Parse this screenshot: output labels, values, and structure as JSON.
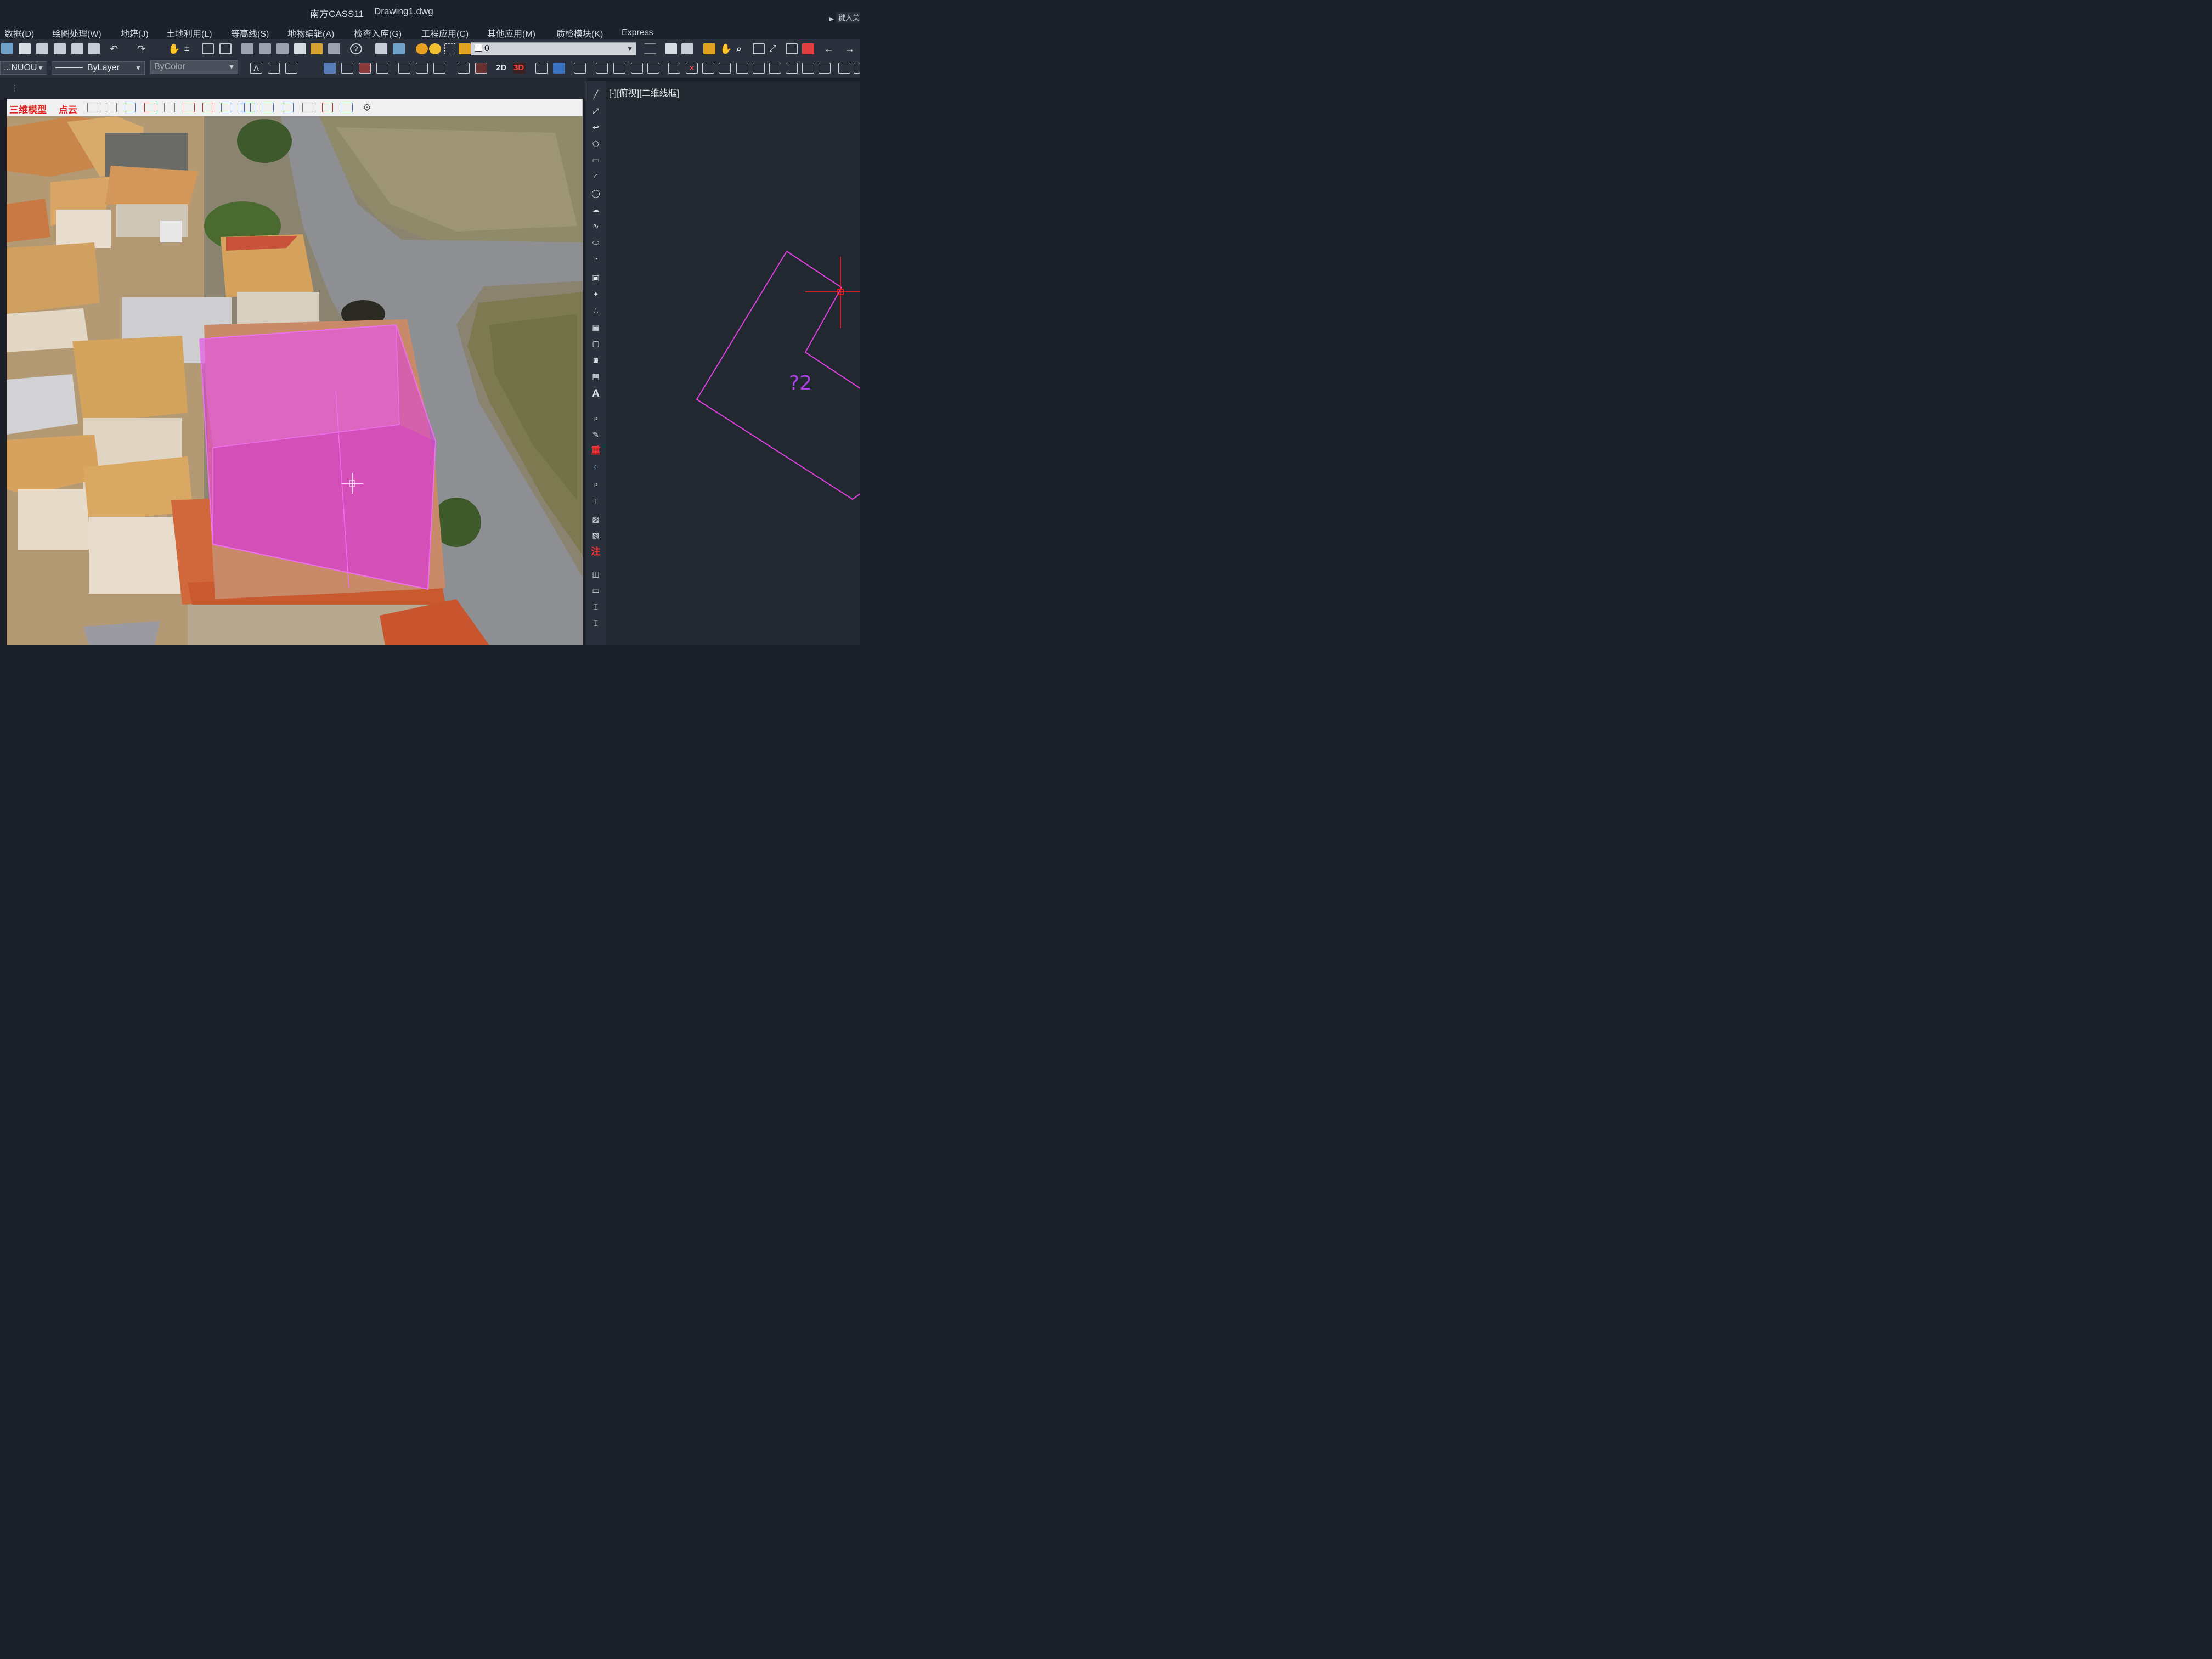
{
  "window": {
    "app_name": "南方CASS11",
    "file_name": "Drawing1.dwg",
    "search_hint": "键入关"
  },
  "menu": {
    "items": [
      "数据(D)",
      "绘图处理(W)",
      "地籍(J)",
      "土地利用(L)",
      "等高线(S)",
      "地物编辑(A)",
      "检查入库(G)",
      "工程应用(C)",
      "其他应用(M)",
      "质检模块(K)",
      "Express"
    ]
  },
  "toolbar1": {
    "layer_value": "0"
  },
  "toolbar2": {
    "layer_name": "...NUOU",
    "linetype": "ByLayer",
    "color": "ByColor",
    "btn_2d": "2D",
    "btn_3d": "3D"
  },
  "model_toolbar": {
    "label_3d": "三维模型",
    "label_cloud": "点云"
  },
  "vertical_toolbar": {
    "btn_text": "A",
    "btn_chong": "重",
    "btn_zhu": "注"
  },
  "canvas2d": {
    "view_label": "[-][俯视][二维线框]",
    "parcel_label": "?2"
  },
  "colors": {
    "accent_magenta": "#e040e0",
    "crosshair_red": "#ff2020",
    "title_bg": "#1c212b",
    "toolbar_bg": "#2b313c",
    "canvas_bg": "#212830"
  }
}
